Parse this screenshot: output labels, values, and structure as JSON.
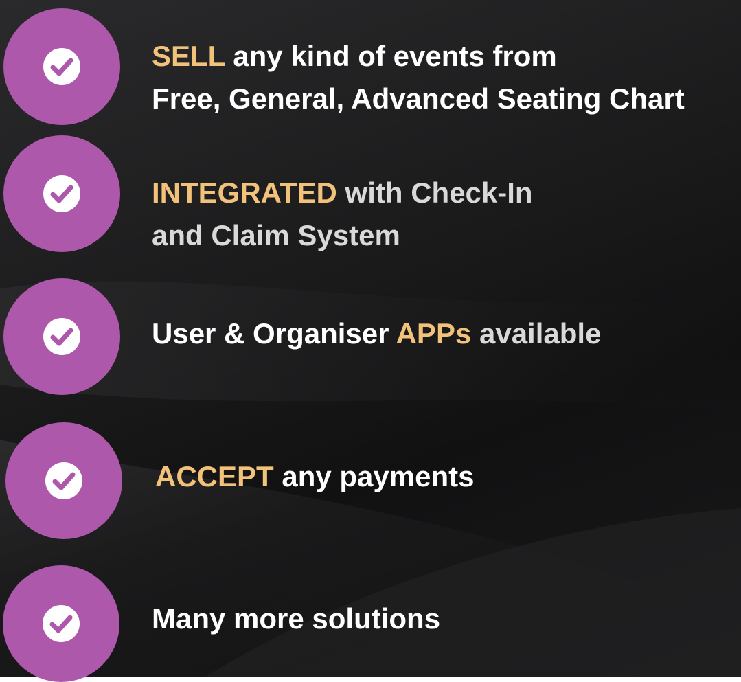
{
  "features": [
    {
      "line1_highlight": "SELL",
      "line1_rest": " any kind of events from",
      "line2": "Free, General, Advanced Seating Chart"
    },
    {
      "line1_highlight": "INTEGRATED",
      "line1_rest": " with Check-In",
      "line2": "and Claim System"
    },
    {
      "line1_pre": "User & Organiser ",
      "line1_highlight": "APPs",
      "line1_rest": " available"
    },
    {
      "line1_highlight": "ACCEPT",
      "line1_rest": " any payments"
    },
    {
      "line1_pre": "Many more solutions"
    }
  ],
  "icons": {
    "badge": "check-circle-icon"
  },
  "colors": {
    "badge": "#ae58ab",
    "highlight": "#f2c27a",
    "text": "#ffffff",
    "background": "#1a1a1b"
  }
}
